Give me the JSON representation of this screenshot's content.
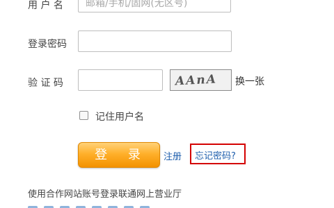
{
  "form": {
    "username_label": "用 户 名",
    "username_placeholder": "邮箱/手机/固网(无区号)",
    "password_label": "登录密码",
    "captcha_label": "验 证 码",
    "captcha_text": "AAnA",
    "refresh_label": "换一张",
    "remember_label": "记住用户名",
    "login_button": "登 录",
    "register_link": "注册",
    "forgot_link": "忘记密码?",
    "partner_text": "使用合作网站账号登录联通网上营业厅"
  },
  "colors": {
    "button": "#f39200",
    "link": "#1f5fad",
    "highlight_border": "#d40000"
  }
}
